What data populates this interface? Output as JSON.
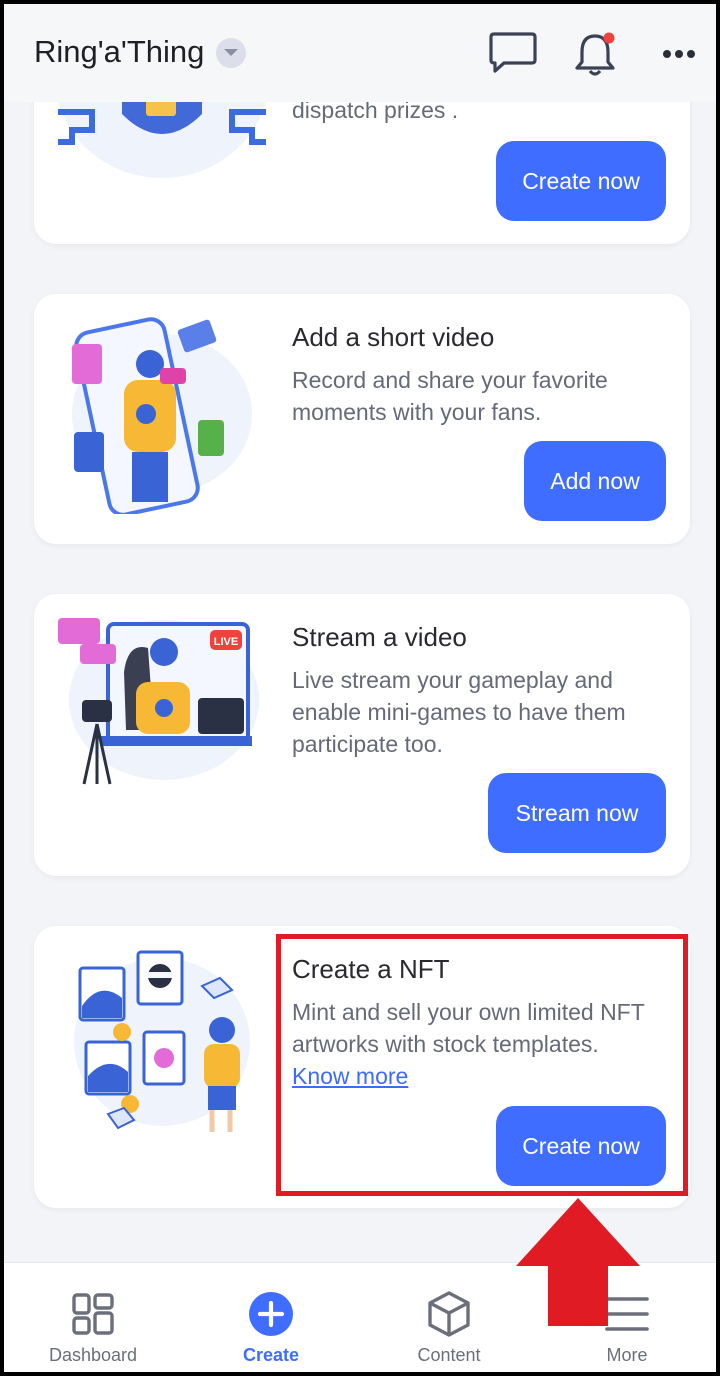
{
  "header": {
    "app_title": "Ring'a'Thing",
    "icons": [
      "chevron-down-icon",
      "chat-icon",
      "bell-icon",
      "more-icon"
    ],
    "notification_dot_color": "#f0423d"
  },
  "cards": [
    {
      "title": "",
      "description": "dispatch prizes .",
      "button": "Create now"
    },
    {
      "title": "Add a short video",
      "description": "Record and share your favorite moments with your fans.",
      "button": "Add now"
    },
    {
      "title": "Stream a video",
      "description": "Live stream your gameplay and enable mini-games to have them participate too.",
      "button": "Stream now",
      "badge": "LIVE"
    },
    {
      "title": "Create a NFT",
      "description": "Mint and sell your own limited NFT artworks with stock templates.",
      "link": "Know more",
      "button": "Create now"
    }
  ],
  "bottom_nav": [
    {
      "label": "Dashboard",
      "icon": "dashboard-icon",
      "active": false
    },
    {
      "label": "Create",
      "icon": "plus-circle-icon",
      "active": true
    },
    {
      "label": "Content",
      "icon": "cube-icon",
      "active": false
    },
    {
      "label": "More",
      "icon": "menu-icon",
      "active": false
    }
  ],
  "colors": {
    "accent": "#3f6dff",
    "highlight": "#e01b24",
    "background": "#f3f4f7"
  }
}
